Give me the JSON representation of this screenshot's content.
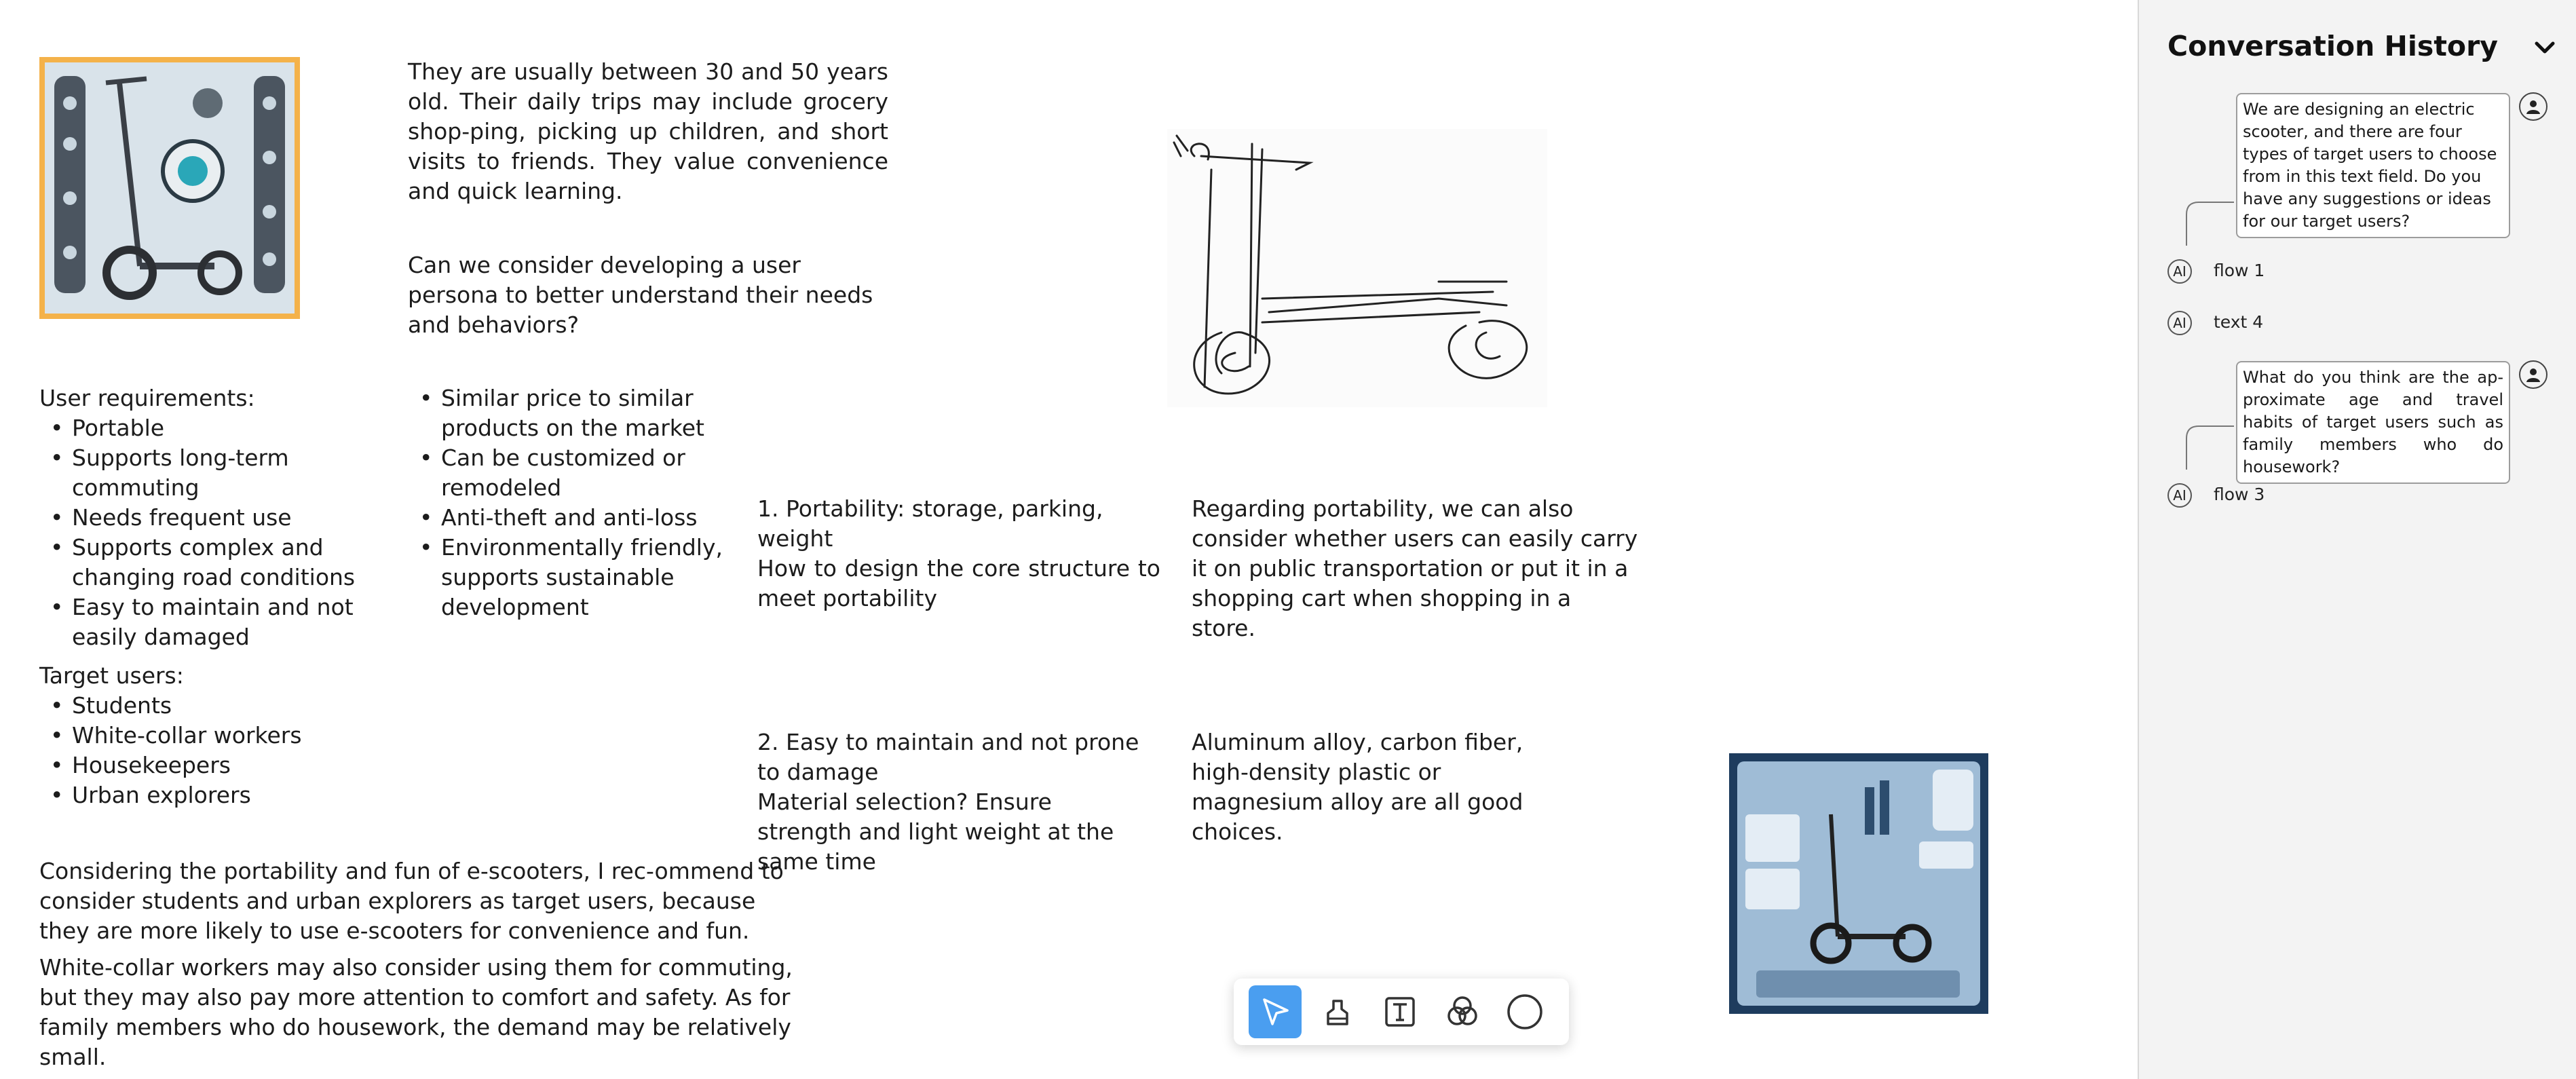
{
  "canvas": {
    "persona_text_1": "They are usually between 30 and 50 years old. Their daily trips may include grocery shop-ping, picking up children, and short visits to friends. They value convenience and quick learning.",
    "persona_text_2": "Can we consider developing a user persona to better understand their needs and behaviors?",
    "requirements": {
      "heading": "User requirements:",
      "items": [
        "Portable",
        "Supports long-term commuting",
        "Needs frequent use",
        "Supports complex and changing road conditions",
        "Easy to maintain and not easily damaged"
      ],
      "items_col2": [
        "Similar price to similar products on the market",
        "Can be customized or remodeled",
        "Anti-theft and anti-loss",
        "Environmentally friendly, supports sustainable development"
      ]
    },
    "target_users": {
      "heading": "Target users:",
      "items": [
        "Students",
        "White-collar workers",
        "Housekeepers",
        "Urban explorers"
      ]
    },
    "recommendation_1": "Considering the portability and fun of e-scooters, I rec-ommend to consider students and urban explorers as target users, because they are more likely to use e-scooters for convenience and fun.",
    "recommendation_2": "White-collar workers may also consider using them for commuting, but they may also pay more attention to comfort and safety. As for family members who do housework, the demand may be relatively small.",
    "portability_point": "1. Portability: storage, parking, weight",
    "portability_question": "How to design the core structure to meet portability",
    "portability_reply": "Regarding portability, we can also consider whether users can easily carry it on public transportation or put it in a shopping cart when shopping in a store.",
    "maintenance_point": "2. Easy to maintain and not prone to damage",
    "maintenance_question": "Material selection? Ensure strength and light weight at the same time",
    "maintenance_reply": "Aluminum alloy, carbon fiber, high-density plastic or magnesium alloy are all good choices."
  },
  "toolbar": {
    "tools": [
      "select-tool",
      "eraser-tool",
      "text-tool",
      "blend-tool",
      "circle-tool"
    ],
    "active": "select-tool",
    "accent": "#4a9ef0"
  },
  "sidebar": {
    "title": "Conversation History",
    "messages": [
      {
        "type": "user",
        "text": "We are designing an electric scooter, and there are four types of target users to choose from in this text field. Do you have any suggestions or ideas for our target users?"
      },
      {
        "type": "ai",
        "label": "flow 1"
      },
      {
        "type": "ai",
        "label": "text 4"
      },
      {
        "type": "user",
        "text": "What do you think are the ap-proximate age and travel habits of target users such as family members who do housework?"
      },
      {
        "type": "ai",
        "label": "flow 3"
      }
    ],
    "ai_badge": "AI"
  },
  "colors": {
    "image_frame": "#f4b24a",
    "sidebar_bg": "#f3f3f3"
  }
}
